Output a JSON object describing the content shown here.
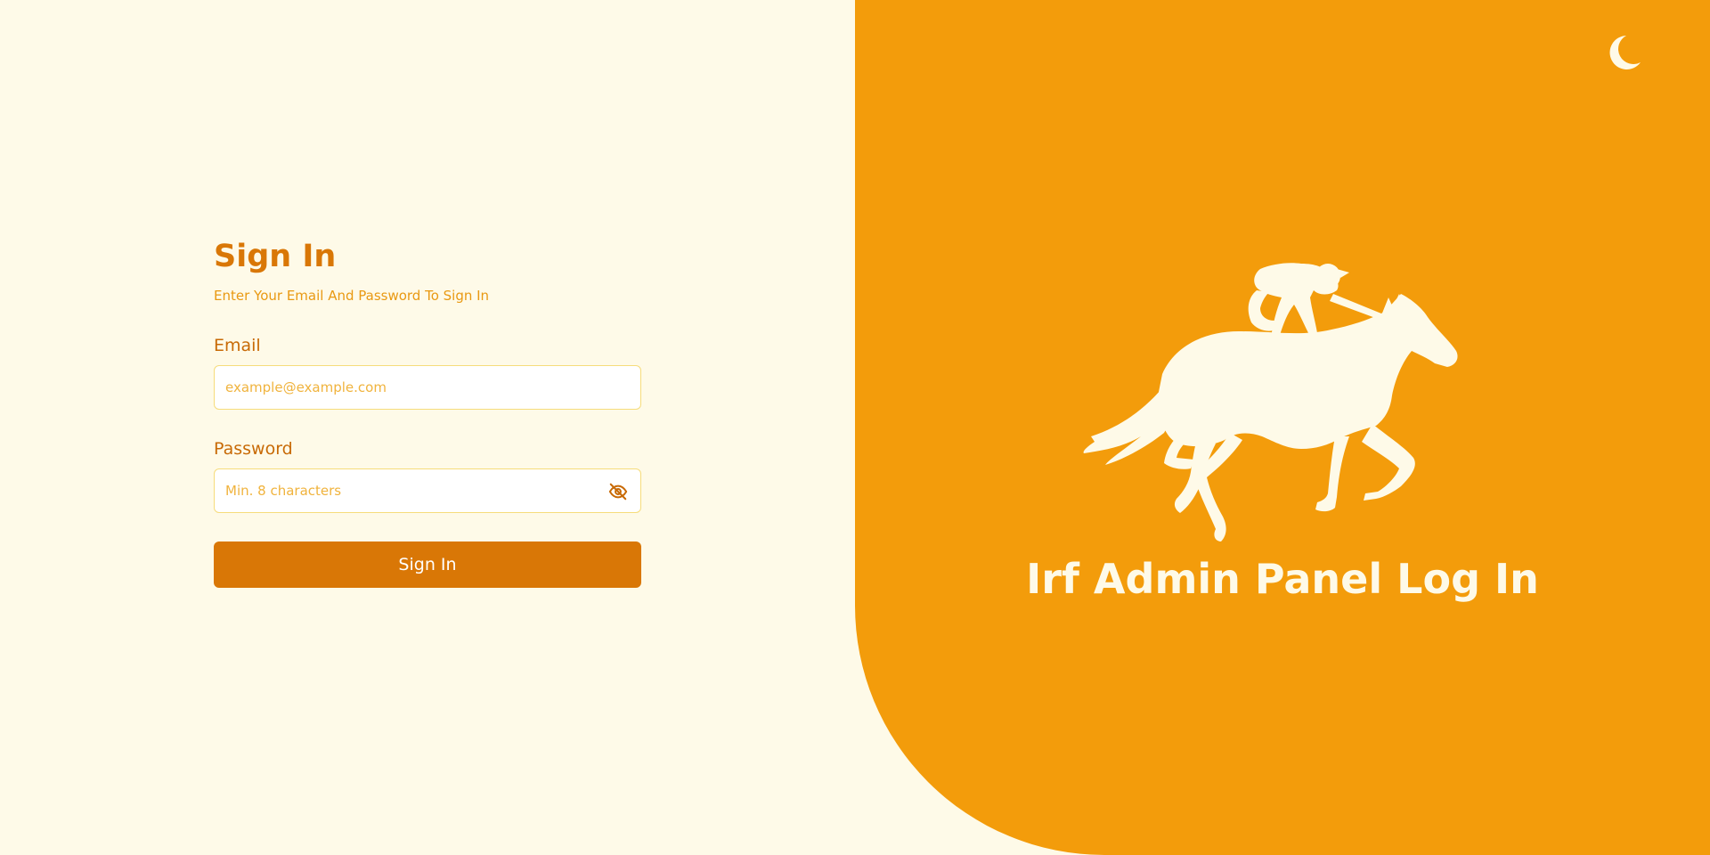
{
  "signin": {
    "title": "Sign In",
    "subtitle": "Enter Your Email And Password To Sign In",
    "email_label": "Email",
    "email_placeholder": "example@example.com",
    "email_value": "",
    "password_label": "Password",
    "password_placeholder": "Min. 8 characters",
    "password_value": "",
    "password_toggle_icon": "eye-off-icon",
    "submit_label": "Sign In"
  },
  "brand": {
    "title": "Irf Admin Panel Log In",
    "illustration": "horse-jockey-silhouette",
    "theme_toggle_icon": "moon-icon"
  },
  "colors": {
    "background": "#fefae8",
    "accent": "#d97706",
    "panel": "#f39c0b",
    "input_border": "#f6dc7b",
    "text_on_panel": "#fefae8"
  }
}
